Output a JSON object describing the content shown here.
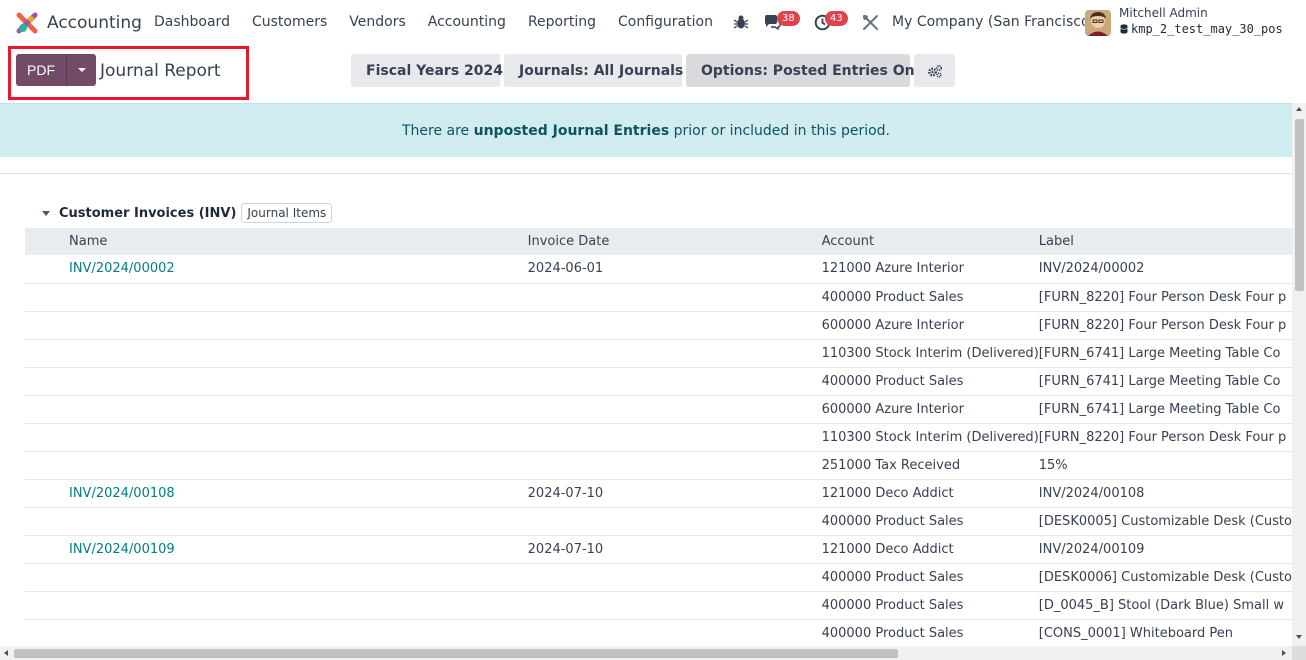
{
  "app": {
    "name": "Accounting",
    "menu": [
      "Dashboard",
      "Customers",
      "Vendors",
      "Accounting",
      "Reporting",
      "Configuration"
    ]
  },
  "systray": {
    "messages_count": "38",
    "activities_count": "43",
    "company": "My Company (San Francisco)",
    "user_name": "Mitchell Admin",
    "database": "kmp_2_test_may_30_pos"
  },
  "control_panel": {
    "pdf_label": "PDF",
    "title": "Journal Report",
    "filters": {
      "fiscal": "Fiscal Years 2024",
      "journals": "Journals: All Journals",
      "options": "Options: Posted Entries Only"
    }
  },
  "alert": {
    "prefix": "There are ",
    "bold": "unposted Journal Entries",
    "suffix": " prior or included in this period."
  },
  "section": {
    "name": "Customer Invoices (INV)",
    "button": "Journal Items"
  },
  "table": {
    "columns": [
      "Name",
      "Invoice Date",
      "Account",
      "Label"
    ],
    "rows": [
      {
        "name": "INV/2024/00002",
        "date": "2024-06-01",
        "account": "121000 Azure Interior",
        "label": "INV/2024/00002"
      },
      {
        "name": "",
        "date": "",
        "account": "400000 Product Sales",
        "label": "[FURN_8220] Four Person Desk Four p"
      },
      {
        "name": "",
        "date": "",
        "account": "600000 Azure Interior",
        "label": "[FURN_8220] Four Person Desk Four p"
      },
      {
        "name": "",
        "date": "",
        "account": "110300 Stock Interim (Delivered)",
        "label": "[FURN_6741] Large Meeting Table Co"
      },
      {
        "name": "",
        "date": "",
        "account": "400000 Product Sales",
        "label": "[FURN_6741] Large Meeting Table Co"
      },
      {
        "name": "",
        "date": "",
        "account": "600000 Azure Interior",
        "label": "[FURN_6741] Large Meeting Table Co"
      },
      {
        "name": "",
        "date": "",
        "account": "110300 Stock Interim (Delivered)",
        "label": "[FURN_8220] Four Person Desk Four p"
      },
      {
        "name": "",
        "date": "",
        "account": "251000 Tax Received",
        "label": "15%"
      },
      {
        "name": "INV/2024/00108",
        "date": "2024-07-10",
        "account": "121000 Deco Addict",
        "label": "INV/2024/00108"
      },
      {
        "name": "",
        "date": "",
        "account": "400000 Product Sales",
        "label": "[DESK0005] Customizable Desk (Custo"
      },
      {
        "name": "INV/2024/00109",
        "date": "2024-07-10",
        "account": "121000 Deco Addict",
        "label": "INV/2024/00109"
      },
      {
        "name": "",
        "date": "",
        "account": "400000 Product Sales",
        "label": "[DESK0006] Customizable Desk (Custo"
      },
      {
        "name": "",
        "date": "",
        "account": "400000 Product Sales",
        "label": "[D_0045_B] Stool (Dark Blue) Small w"
      },
      {
        "name": "",
        "date": "",
        "account": "400000 Product Sales",
        "label": "[CONS_0001] Whiteboard Pen"
      }
    ]
  },
  "colors": {
    "primary": "#714b67",
    "link": "#017e84",
    "alert_bg": "#d1ecf1",
    "highlight": "#e8192c"
  }
}
